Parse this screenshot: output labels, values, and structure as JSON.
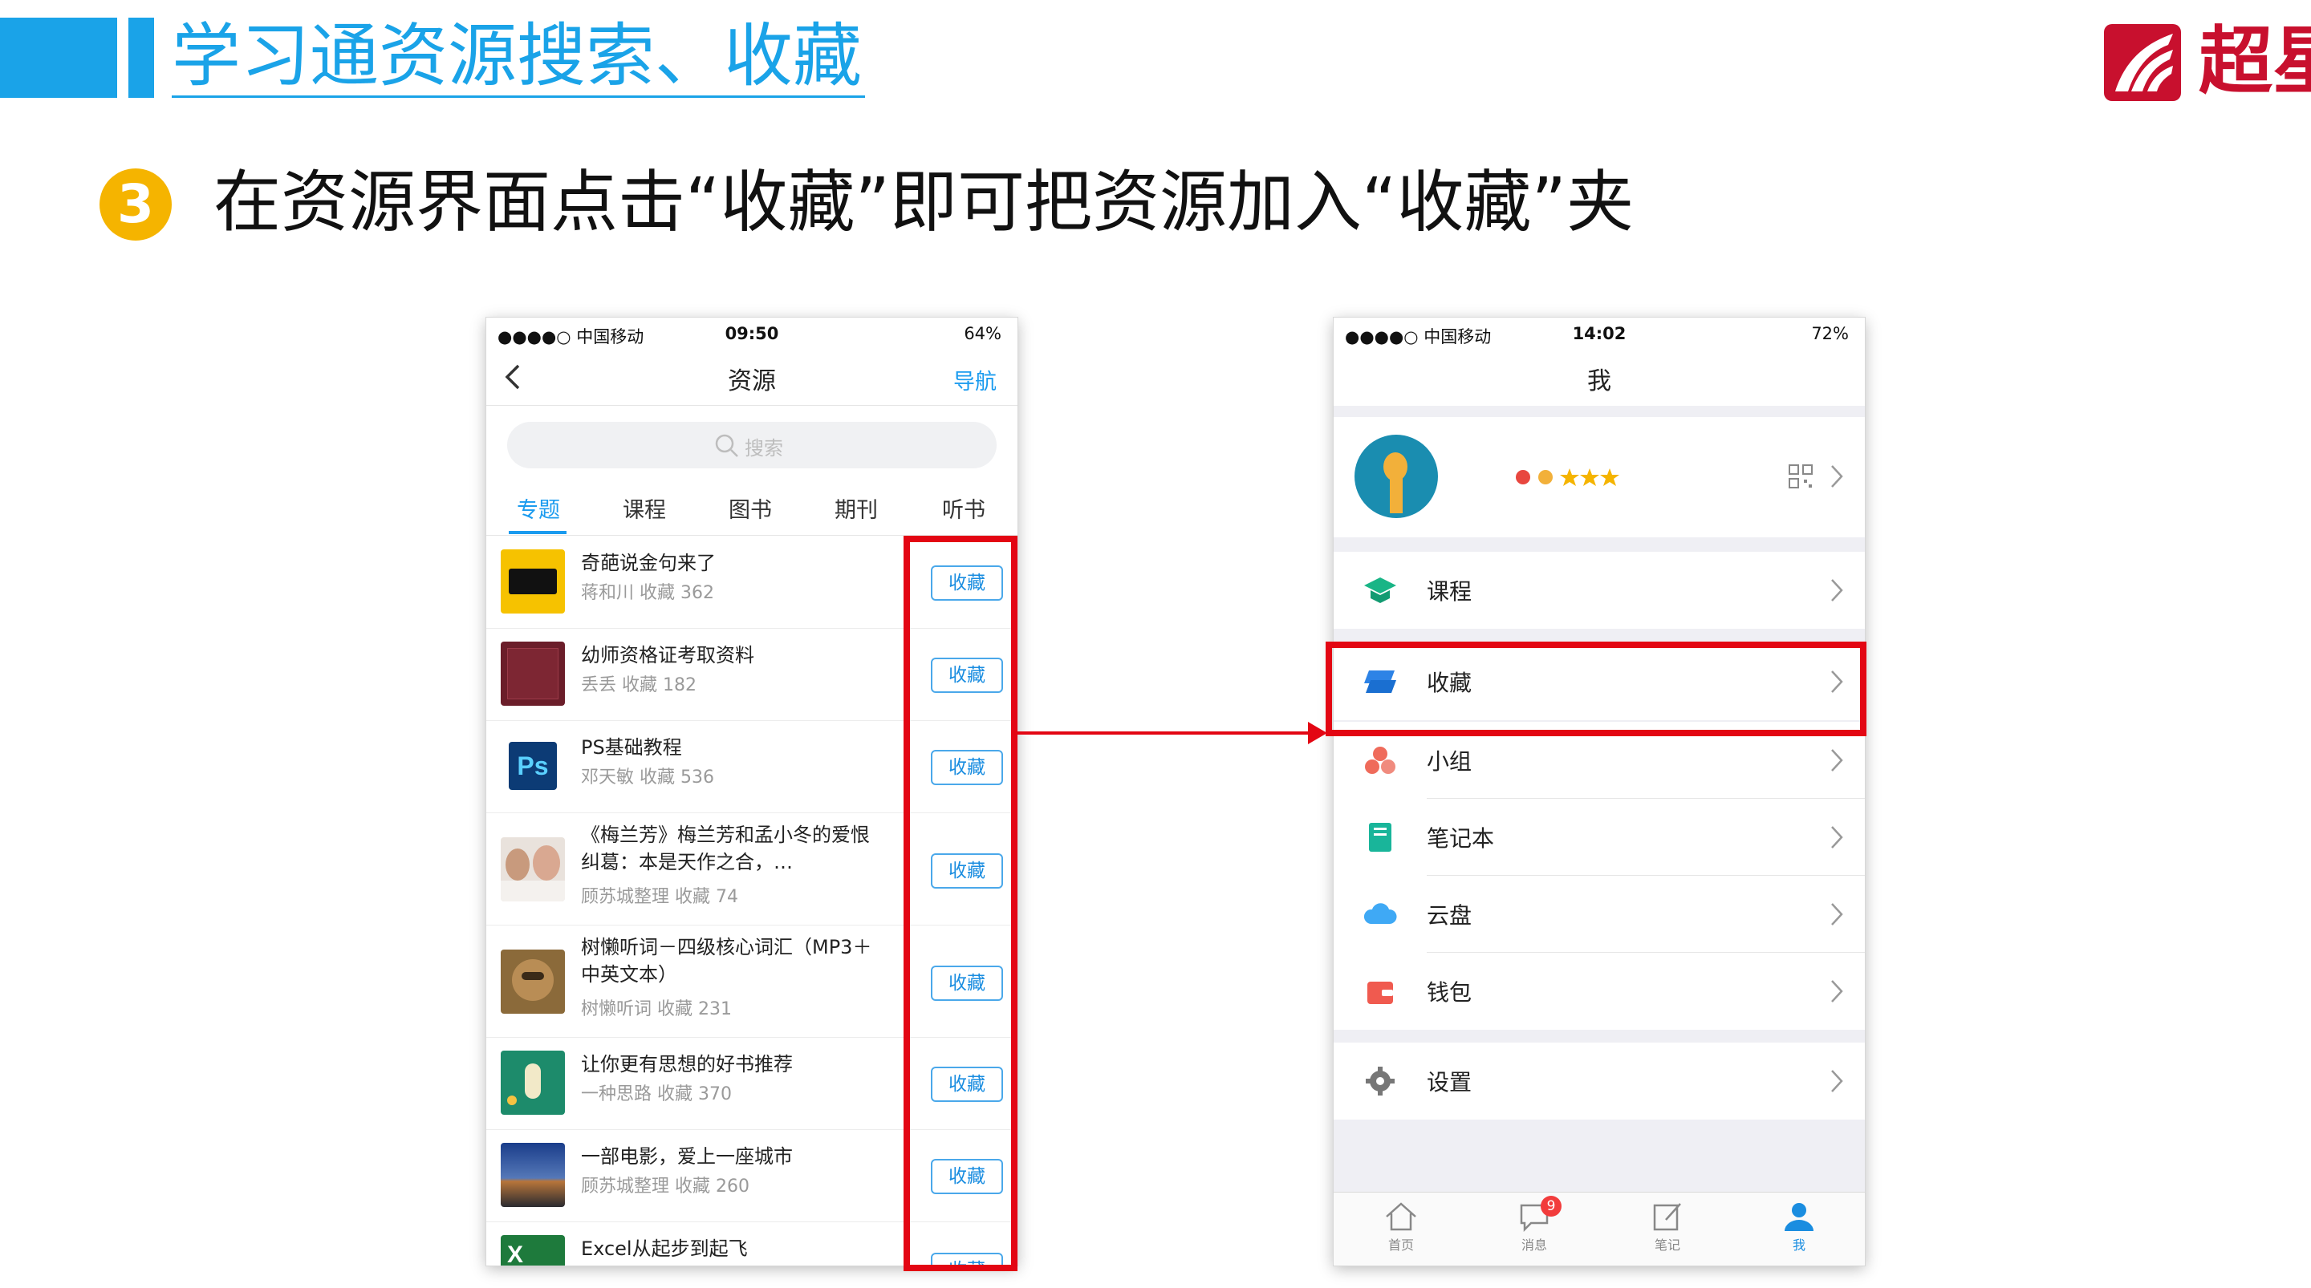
{
  "header": {
    "title": "学习通资源搜索、收藏",
    "logo_text": "超星"
  },
  "step": {
    "number": "3",
    "text": "在资源界面点击“收藏”即可把资源加入“收藏”夹"
  },
  "phone_left": {
    "status": {
      "carrier": "●●●●○ 中国移动",
      "time": "09:50",
      "battery": "64%"
    },
    "nav": {
      "title": "资源",
      "right_link": "导航"
    },
    "search_placeholder": "搜索",
    "tabs": [
      "专题",
      "课程",
      "图书",
      "期刊",
      "听书"
    ],
    "items": [
      {
        "title": "奇葩说金句来了",
        "meta": "蒋和川    收藏 362",
        "button": "收藏"
      },
      {
        "title": "幼师资格证考取资料",
        "meta": "丢丢    收藏 182",
        "button": "收藏"
      },
      {
        "title": "PS基础教程",
        "meta": "邓天敏    收藏 536",
        "button": "收藏"
      },
      {
        "title": "《梅兰芳》梅兰芳和孟小冬的爱恨纠葛：本是天作之合，…",
        "meta": "顾苏城整理    收藏 74",
        "button": "收藏"
      },
      {
        "title": "树懒听词－四级核心词汇（MP3＋中英文本）",
        "meta": "树懒听词    收藏 231",
        "button": "收藏"
      },
      {
        "title": "让你更有思想的好书推荐",
        "meta": "一种思路    收藏 370",
        "button": "收藏"
      },
      {
        "title": "一部电影，爱上一座城市",
        "meta": "顾苏城整理    收藏 260",
        "button": "收藏"
      },
      {
        "title": "Excel从起步到起飞",
        "meta": "",
        "button": "收藏"
      }
    ]
  },
  "phone_right": {
    "status": {
      "carrier": "●●●●○ 中国移动",
      "time": "14:02",
      "battery": "72%"
    },
    "nav": {
      "title": "我"
    },
    "menu": [
      {
        "label": "课程"
      },
      {
        "label": "收藏"
      },
      {
        "label": "小组"
      },
      {
        "label": "笔记本"
      },
      {
        "label": "云盘"
      },
      {
        "label": "钱包"
      },
      {
        "label": "设置"
      }
    ],
    "tabbar": [
      {
        "label": "首页"
      },
      {
        "label": "消息",
        "badge": "9"
      },
      {
        "label": "笔记"
      },
      {
        "label": "我"
      }
    ]
  },
  "colors": {
    "accent": "#1aa3e8",
    "highlight": "#e30613",
    "step_badge": "#f5b400",
    "link": "#1a9bef"
  }
}
